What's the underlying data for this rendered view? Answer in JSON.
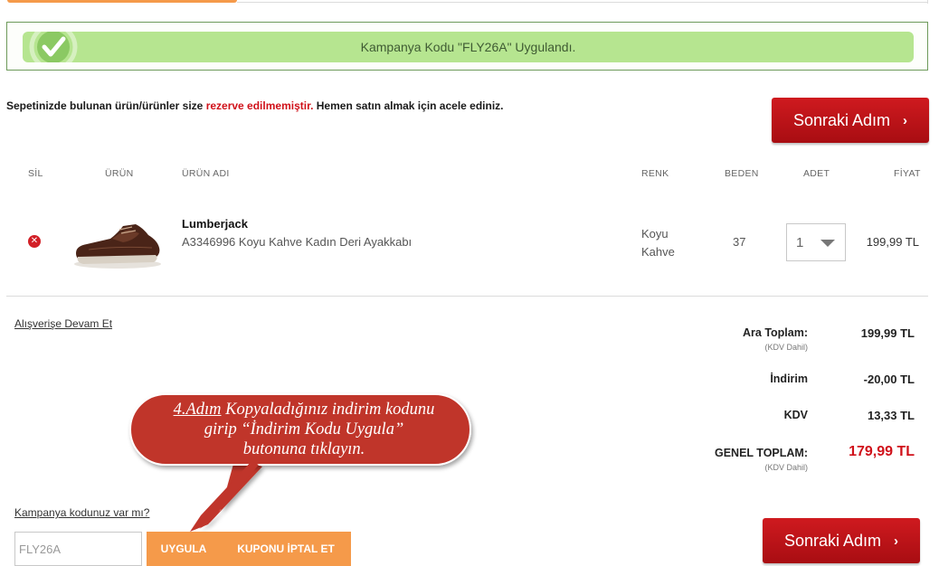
{
  "alert": {
    "message": "Kampanya Kodu \"FLY26A\" Uygulandı.",
    "icon": "check-icon",
    "color": "#b6e590"
  },
  "notice": {
    "part1": "Sepetinizde bulunan ürün/ürünler size ",
    "highlight": "rezerve edilmemiştir.",
    "part2": " Hemen satın almak için acele ediniz."
  },
  "buttons": {
    "next_step": "Sonraki Adım",
    "next_icon": "chevron-right-icon"
  },
  "table": {
    "headers": {
      "remove": "SİL",
      "product": "ÜRÜN",
      "product_name": "ÜRÜN ADI",
      "color": "RENK",
      "size": "BEDEN",
      "quantity": "ADET",
      "price": "FİYAT"
    },
    "items": [
      {
        "brand": "Lumberjack",
        "name": "A3346996 Koyu Kahve Kadın Deri Ayakkabı",
        "color": "Koyu Kahve",
        "size": "37",
        "quantity": "1",
        "price": "199,99 TL"
      }
    ]
  },
  "links": {
    "continue_shopping": "Alışverişe Devam Et",
    "have_campaign": "Kampanya kodunuz var mı?"
  },
  "summary": {
    "subtotal_label": "Ara Toplam:",
    "subtotal_note": "(KDV Dahil)",
    "subtotal_value": "199,99 TL",
    "discount_label": "İndirim",
    "discount_value": "-20,00 TL",
    "vat_label": "KDV",
    "vat_value": "13,33 TL",
    "total_label": "GENEL TOPLAM:",
    "total_note": "(KDV Dahil)",
    "total_value": "179,99 TL"
  },
  "coupon": {
    "input_value": "FLY26A",
    "apply_label": "UYGULA",
    "cancel_label": "KUPONU İPTAL ET"
  },
  "callout": {
    "step": "4.Adım",
    "line1_rest": " Kopyaladığınız indirim kodunu",
    "line2": "girip “İndirim Kodu Uygula”",
    "line3": "butonuna tıklayın.",
    "color": "#c0352b"
  },
  "colors": {
    "accent_orange": "#f59a4a",
    "brand_red": "#c8141a",
    "success_green": "#b6e590"
  }
}
